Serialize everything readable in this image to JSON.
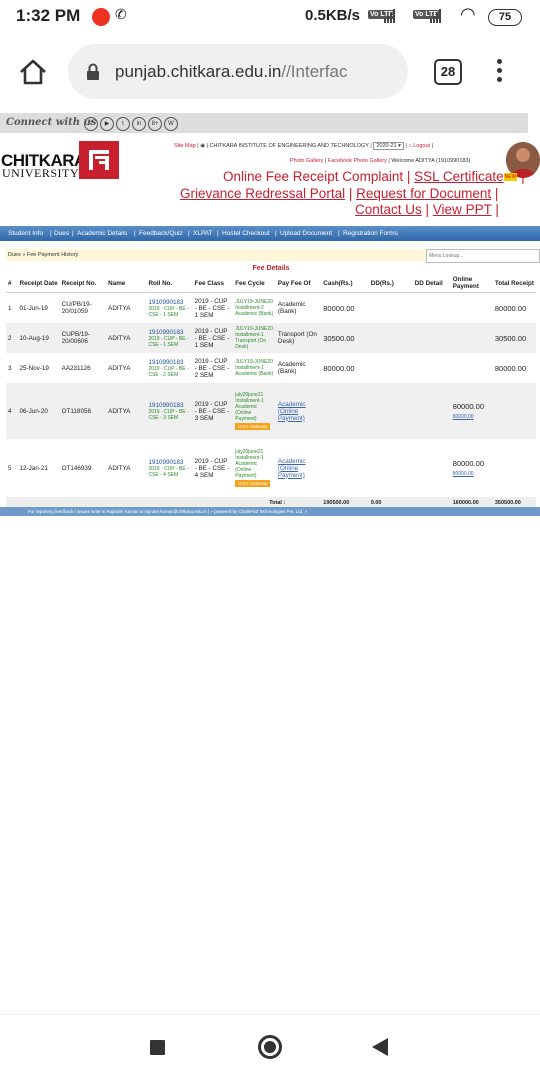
{
  "status_bar": {
    "time": "1:32 PM",
    "net_speed": "0.5KB/s",
    "lte1": "Vo LTE",
    "lte2": "Vo LTE",
    "battery": "75"
  },
  "browser": {
    "url_main": "punjab.chitkara.edu.in",
    "url_path": "//Interfac",
    "tab_count": "28"
  },
  "header": {
    "connect_label": "Connect with us",
    "social_icons": [
      "f",
      "▶",
      "t",
      "in",
      "8+",
      "W"
    ],
    "logo_line1": "CHITKARA",
    "logo_line2": "UNIVERSITY",
    "site_map": "Site Map",
    "institute": "CHITKARA INSTITUTE OF ENGINEERING AND TECHNOLOGY",
    "session": "2020-21",
    "logout": "Logout",
    "photo_gallery": "Photo Gallery",
    "facebook_gallery": "Facebook Photo Gallery",
    "welcome": "Welcome ADITYA (1910990183)",
    "link_fee_complaint": "Online Fee Receipt Complaint",
    "link_ssl": "SSL Certificate",
    "new_badge": "NEW",
    "link_grievance": "Grievance Redressal Portal",
    "link_request_doc": "Request for Document",
    "link_contact": "Contact Us",
    "link_ppt": "View PPT"
  },
  "nav": {
    "items": [
      "Student Info",
      "Dues",
      "Academic Details",
      "Feedback/Quiz",
      "XLPAT",
      "Hostel Checkout",
      "Upload Document",
      "Registration Forms"
    ]
  },
  "breadcrumb": "Dues » Fee Payment History",
  "lookup_placeholder": "Menu Lookup...",
  "fee_table": {
    "title": "Fee Details",
    "columns": [
      "#",
      "Receipt Date",
      "Receipt No.",
      "Name",
      "Roll No.",
      "Fee Class",
      "Fee Cycle",
      "Pay Fee Of",
      "Cash(Rs.)",
      "DD(Rs.)",
      "DD Detail",
      "Online Payment",
      "Total Receipt"
    ],
    "rows": [
      {
        "n": "1",
        "date": "01-Jun-19",
        "receipt": "CU/PB/19-20/01059",
        "name": "ADITYA",
        "roll": "1910990183",
        "roll_sub": "2019 - CUP - BE - CSE - 1 SEM",
        "fee_class": "2019 - CUP - BE - CSE - 1 SEM",
        "cycle": "JULY19-JUNE20 Installment-2 Academic (Bank)",
        "pay_of": "Academic (Bank)",
        "cash": "80000.00",
        "dd": "",
        "dd_detail": "",
        "online": "",
        "online_link": "",
        "total": "80000.00",
        "gateway": ""
      },
      {
        "n": "2",
        "date": "10-Aug-19",
        "receipt": "CUPB/19-20/00606",
        "name": "ADITYA",
        "roll": "1910990183",
        "roll_sub": "2019 - CUP - BE - CSE - 1 SEM",
        "fee_class": "2019 - CUP - BE - CSE - 1 SEM",
        "cycle": "JULY19-JUNE20 Installment-1 Transport (On Desk)",
        "pay_of": "Transport (On Desk)",
        "cash": "30500.00",
        "dd": "",
        "dd_detail": "",
        "online": "",
        "online_link": "",
        "total": "30500.00",
        "gateway": ""
      },
      {
        "n": "3",
        "date": "25-Nov-19",
        "receipt": "AA231126",
        "name": "ADITYA",
        "roll": "1910990183",
        "roll_sub": "2019 - CUP - BE - CSE - 2 SEM",
        "fee_class": "2019 - CUP - BE - CSE - 2 SEM",
        "cycle": "JULY19-JUNE20 Installment-1 Academic (Bank)",
        "pay_of": "Academic (Bank)",
        "cash": "80000.00",
        "dd": "",
        "dd_detail": "",
        "online": "",
        "online_link": "",
        "total": "80000.00",
        "gateway": ""
      },
      {
        "n": "4",
        "date": "06-Jun-20",
        "receipt": "OT118056",
        "name": "ADITYA",
        "roll": "1910990183",
        "roll_sub": "2019 - CUP - BE - CSE - 3 SEM",
        "fee_class": "2019 - CUP - BE - CSE - 3 SEM",
        "cycle": "july20june21 Installment-1 Academic (Online Payment)",
        "pay_of": "Academic (Online Payment)",
        "cash": "",
        "dd": "",
        "dd_detail": "",
        "online": "80000.00",
        "online_link": "80000.00",
        "total": "",
        "gateway": "ICICI Gateway"
      },
      {
        "n": "5",
        "date": "12-Jan-21",
        "receipt": "OT146939",
        "name": "ADITYA",
        "roll": "1910990183",
        "roll_sub": "2019 - CUP - BE - CSE - 4 SEM",
        "fee_class": "2019 - CUP - BE - CSE - 4 SEM",
        "cycle": "july20june21 Installment-1 Academic (Online Payment)",
        "pay_of": "Academic (Online Payment)",
        "cash": "",
        "dd": "",
        "dd_detail": "",
        "online": "80000.00",
        "online_link": "80000.00",
        "total": "",
        "gateway": "ICICI Gateway"
      }
    ],
    "totals": {
      "label": "Total :",
      "cash": "190500.00",
      "dd": "0.00",
      "online": "160000.00",
      "total": "350500.00"
    }
  },
  "footer_text": "For reporting feedback / issues write to Rajinder Kumar at rajinder.kumar@chitkara.edu.in | » powered by ChalkPad Technologies Pvt. Ltd. »",
  "colors": {
    "brand_red": "#c8202f",
    "nav_blue": "#2f67a9"
  }
}
